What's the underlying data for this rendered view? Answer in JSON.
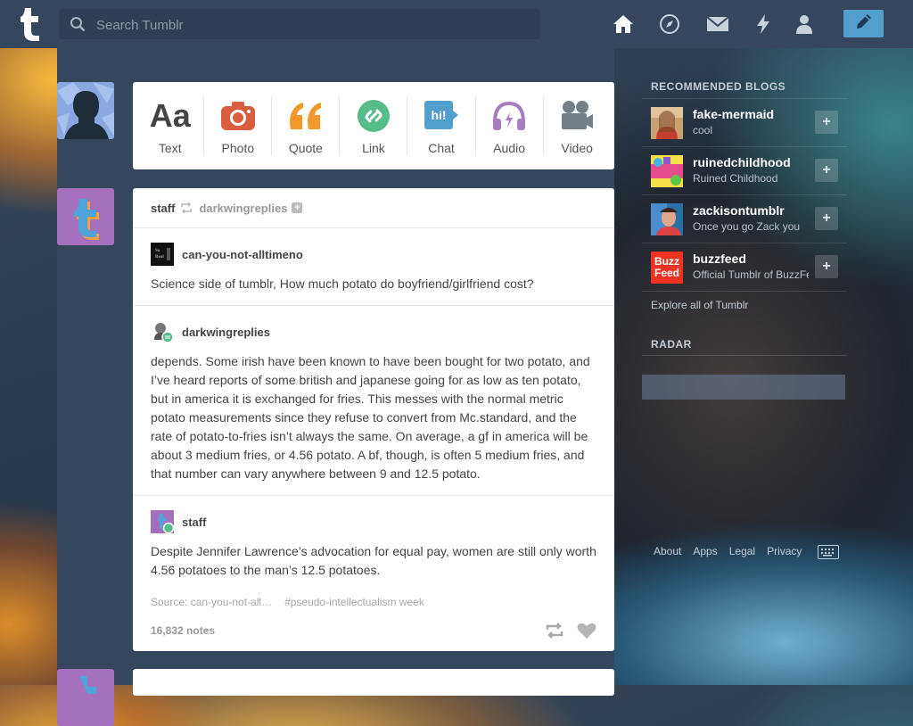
{
  "nav": {
    "search_placeholder": "Search Tumblr",
    "icons": [
      "home-icon",
      "explore-icon",
      "inbox-icon",
      "activity-icon",
      "account-icon",
      "compose-icon"
    ],
    "compose_color": "#529ecc",
    "bar_color": "#36465d"
  },
  "post_types": [
    {
      "label": "Text"
    },
    {
      "label": "Photo"
    },
    {
      "label": "Quote"
    },
    {
      "label": "Link"
    },
    {
      "label": "Chat"
    },
    {
      "label": "Audio"
    },
    {
      "label": "Video"
    }
  ],
  "post": {
    "reblogger": "staff",
    "reblogged_from": "darkwingreplies",
    "thread": [
      {
        "author": "can-you-not-alltimeno",
        "text": "Science side of tumblr, How much potato do boyfriend/girlfriend cost?"
      },
      {
        "author": "darkwingreplies",
        "text": "depends. Some irish have been known to have been bought for two potato, and I’ve heard reports of some british and japanese going for as low as ten potato, but in america it is exchanged for fries. This messes with the normal metric potato measurements since they refuse to convert from Mc.standard, and the rate of potato-to-fries isn’t always the same. On average, a gf in america will be about 3 medium fries, or 4.56 potato. A bf, though, is often 5 medium fries, and that number can vary anywhere between 9 and 12.5 potato."
      },
      {
        "author": "staff",
        "text": "Despite Jennifer Lawrence’s advocation for equal pay, women are still only worth 4.56 potatoes to the man’s 12.5 potatoes."
      }
    ],
    "source": "Source: can-you-not-all…",
    "tag": "#pseudo-intellectualism week",
    "notes": "16,832 notes"
  },
  "sidebar": {
    "recommended_title": "RECOMMENDED BLOGS",
    "blogs": [
      {
        "name": "fake-mermaid",
        "desc": "cool"
      },
      {
        "name": "ruinedchildhood",
        "desc": "Ruined Childhood"
      },
      {
        "name": "zackisontumblr",
        "desc": "Once you go Zack you"
      },
      {
        "name": "buzzfeed",
        "desc": "Official Tumblr of BuzzFeed"
      }
    ],
    "follow_label": "+",
    "explore": "Explore all of Tumblr",
    "radar_title": "RADAR",
    "footer": [
      "About",
      "Apps",
      "Legal",
      "Privacy"
    ],
    "buzzfeed_logo": "Buzz Feed"
  }
}
